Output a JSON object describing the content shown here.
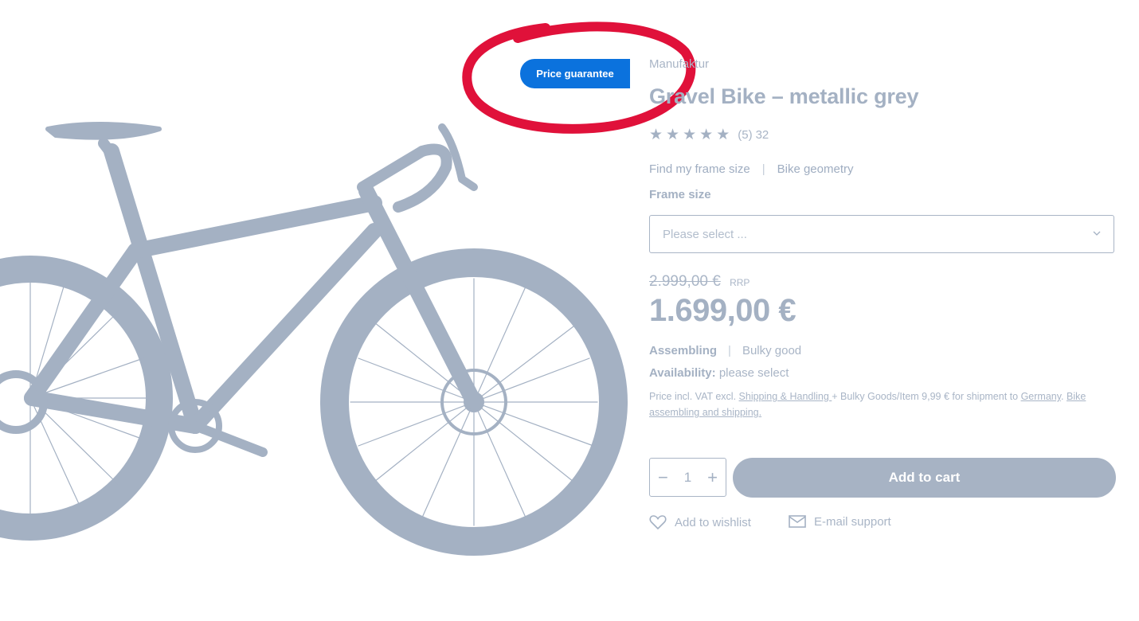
{
  "product": {
    "badge": "Price guarantee",
    "manufacturer": "Manufaktur",
    "title": "Gravel Bike – metallic grey",
    "rating": {
      "stars": 5,
      "display": "(5)",
      "reviews": "32"
    },
    "links": {
      "frame_size": "Find my frame size",
      "separator": "|",
      "geometry": "Bike geometry"
    },
    "frame_size_label": "Frame size",
    "frame_size_placeholder": "Please select ...",
    "old_price": "2.999,00 €",
    "old_price_suffix": "RRP",
    "price": "1.699,00 €",
    "tags": {
      "assembling": "Assembling",
      "separator": "|",
      "bulky": "Bulky good"
    },
    "availability": {
      "label": "Availability:",
      "value": "please select"
    },
    "vat": {
      "part1": "Price incl. VAT excl. ",
      "shipping_link": "Shipping & Handling ",
      "part2": "+ Bulky Goods/Item 9,99 € for shipment to ",
      "country_link": "Germany",
      "part3": ". ",
      "assembly_link": "Bike assembling and shipping."
    },
    "quantity": "1",
    "qty_minus": "−",
    "qty_plus": "+",
    "add_to_cart": "Add to cart",
    "wishlist": "Add to wishlist",
    "email_support": "E-mail support"
  },
  "colors": {
    "badge_blue": "#0b72dd",
    "annotation_red": "#e0113a",
    "muted": "#a4b1c3"
  },
  "icons": [
    "star-icon",
    "chevron-down-icon",
    "heart-icon",
    "mail-icon"
  ]
}
